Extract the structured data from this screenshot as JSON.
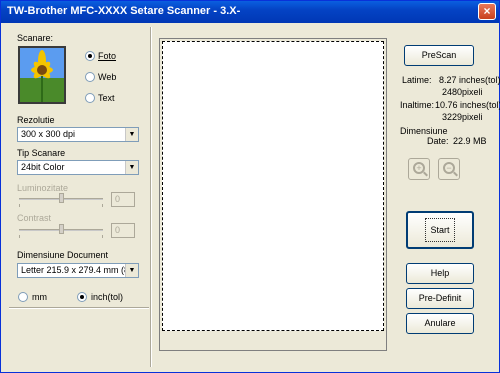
{
  "window": {
    "title": "TW-Brother MFC-XXXX Setare Scanner - 3.X-",
    "close_label": "×"
  },
  "scan_type": {
    "label": "Scanare:",
    "options": [
      {
        "label": "Foto",
        "checked": true
      },
      {
        "label": "Web",
        "checked": false
      },
      {
        "label": "Text",
        "checked": false
      }
    ]
  },
  "resolution": {
    "label": "Rezolutie",
    "value": "300 x 300 dpi"
  },
  "scan_mode": {
    "label": "Tip Scanare",
    "value": "24bit Color"
  },
  "brightness": {
    "label": "Luminozitate",
    "value": "0"
  },
  "contrast": {
    "label": "Contrast",
    "value": "0"
  },
  "document_size": {
    "label": "Dimensiune Document",
    "value": "Letter 215.9 x 279.4 mm (8"
  },
  "units": [
    {
      "label": "mm",
      "checked": false
    },
    {
      "label": "inch(tol)",
      "checked": true
    }
  ],
  "info": {
    "width_label": "Latime:",
    "width_inches": "8.27 inches(tol)",
    "width_pixels": "2480pixeli",
    "height_label": "Inaltime:",
    "height_inches": "10.76 inches(tol)",
    "height_pixels": "3229pixeli",
    "size_label_1": "Dimensiune",
    "size_label_2": "Date:",
    "size_value": "22.9 MB"
  },
  "buttons": {
    "prescan": "PreScan",
    "start": "Start",
    "help": "Help",
    "defaults": "Pre-Definit",
    "cancel": "Anulare"
  },
  "icons": {
    "zoom_in": "zoom-in-icon",
    "zoom_out": "zoom-out-icon"
  }
}
